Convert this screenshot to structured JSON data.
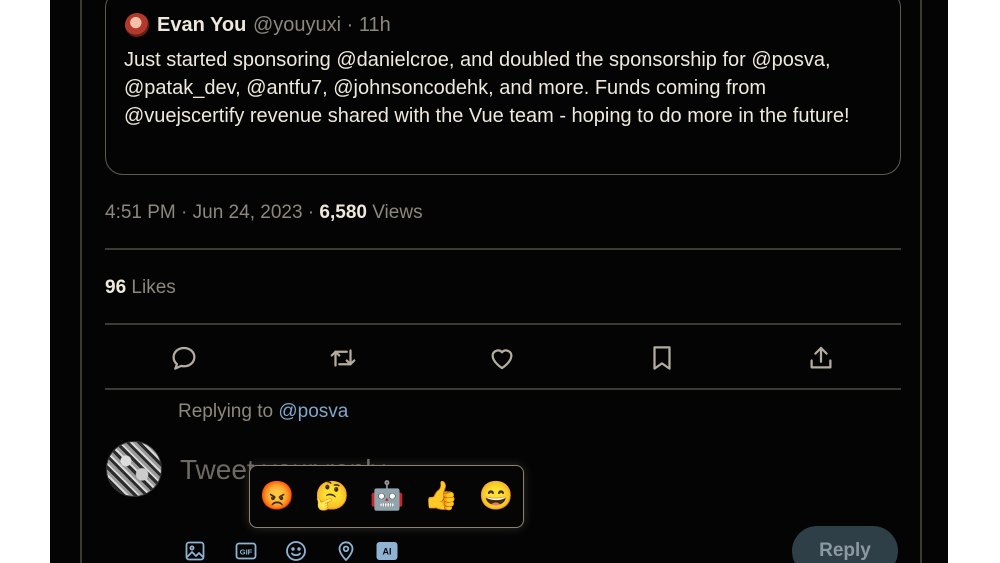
{
  "quoted_tweet": {
    "author": "Evan You",
    "handle_time": "@youyuxi · 11h",
    "text": "Just started sponsoring @danielcroe, and doubled the sponsorship for @posva, @patak_dev, @antfu7, @johnsoncodehk, and more. Funds coming from @vuejscertify revenue shared with the Vue team - hoping to do more in the future!"
  },
  "meta": {
    "time_date": "4:51 PM · Jun 24, 2023 · ",
    "views_count": "6,580",
    "views_label": " Views"
  },
  "likes": {
    "count": "96",
    "label": " Likes"
  },
  "actions": [
    "reply-icon",
    "retweet-icon",
    "like-icon",
    "bookmark-icon",
    "share-icon"
  ],
  "reply": {
    "replying_prefix": "Replying to ",
    "replying_to": "@posva",
    "compose_text": "Tweet your reply",
    "button_label": "Reply"
  },
  "emoji_suggestions": [
    "😡",
    "🤔",
    "🤖",
    "👍",
    "😄"
  ],
  "compose_tools": {
    "icons": [
      "image-icon",
      "gif-icon",
      "emoji-icon",
      "location-icon",
      "ai-icon"
    ],
    "gif_label": "GIF",
    "ai_label": "AI"
  },
  "colors": {
    "background": "#040404",
    "text": "#efe9dc",
    "muted": "#8d877c",
    "accent": "#8fb3d3",
    "divider": "#3d3a35"
  }
}
